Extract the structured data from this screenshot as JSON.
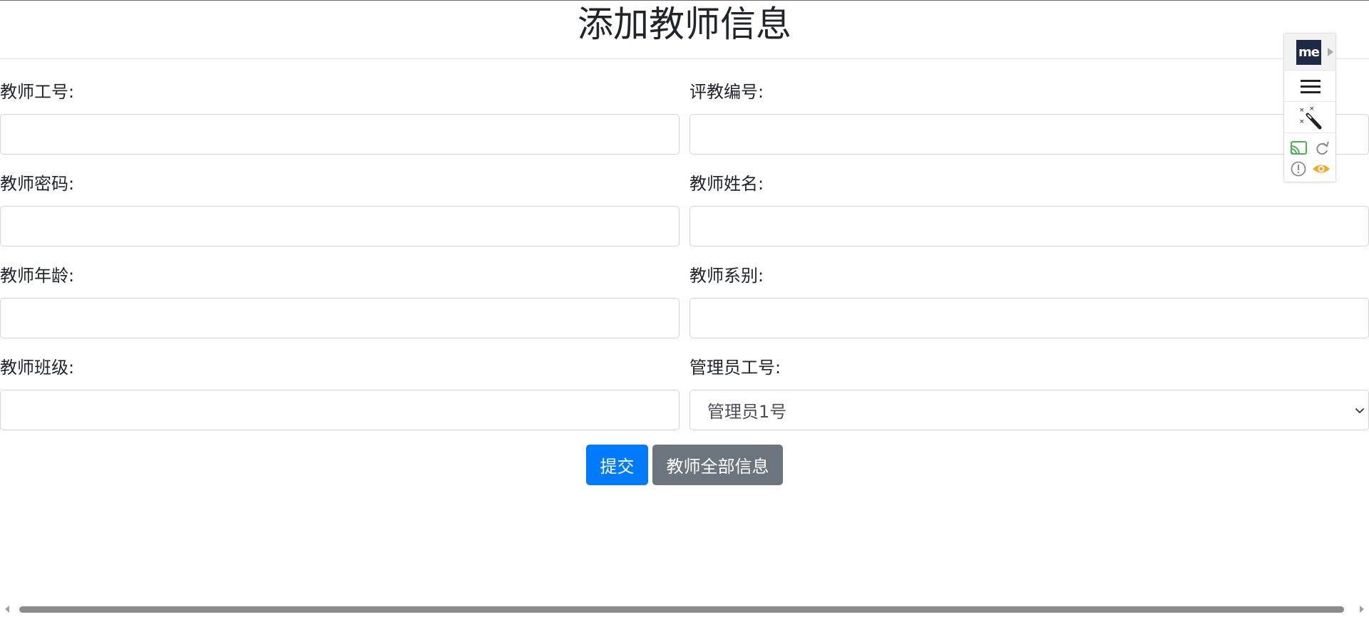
{
  "header": {
    "title": "添加教师信息"
  },
  "form": {
    "fields": [
      {
        "label": "教师工号:",
        "value": ""
      },
      {
        "label": "评教编号:",
        "value": ""
      },
      {
        "label": "教师密码:",
        "value": ""
      },
      {
        "label": "教师姓名:",
        "value": ""
      },
      {
        "label": "教师年龄:",
        "value": ""
      },
      {
        "label": "教师系别:",
        "value": ""
      },
      {
        "label": "教师班级:",
        "value": ""
      },
      {
        "label": "管理员工号:",
        "selected": "管理员1号"
      }
    ],
    "submit_label": "提交",
    "all_info_label": "教师全部信息"
  },
  "toolbar": {
    "logo_text": "me",
    "icons": [
      "menu-icon",
      "magic-wand-icon",
      "cast-icon",
      "refresh-icon",
      "alert-icon",
      "eye-icon"
    ]
  },
  "colors": {
    "primary": "#007bff",
    "secondary": "#6c757d",
    "logo_bg": "#1c2a46",
    "cast_green": "#4caf50",
    "eye_orange": "#f5a623"
  }
}
